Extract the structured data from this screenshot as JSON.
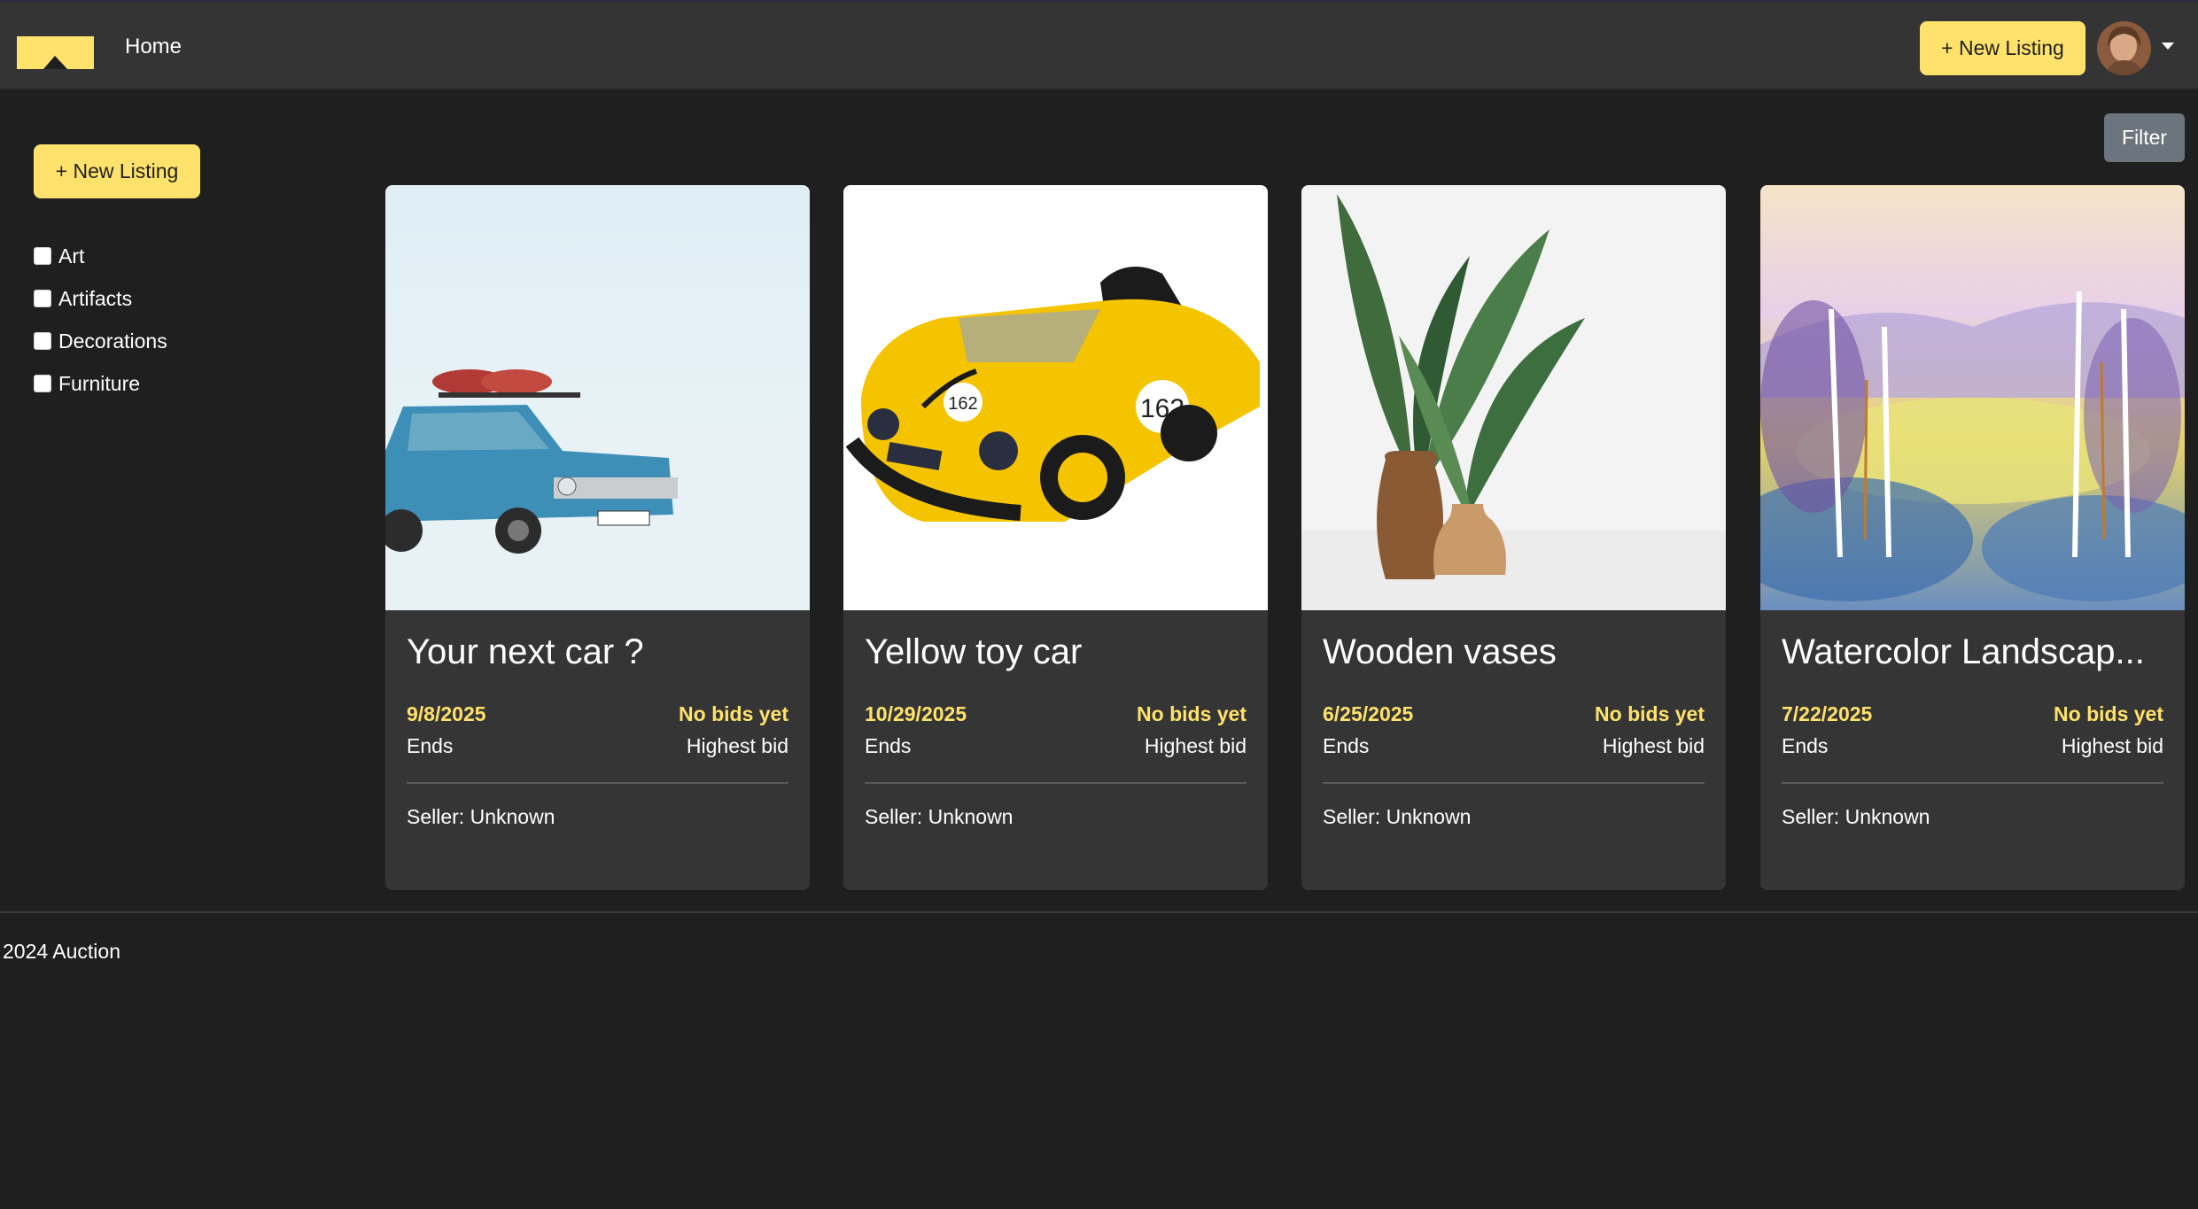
{
  "navbar": {
    "home_label": "Home",
    "new_listing_label": "+ New Listing"
  },
  "sidebar": {
    "new_listing_label": "+ New Listing",
    "categories": [
      {
        "label": "Art",
        "checked": false
      },
      {
        "label": "Artifacts",
        "checked": false
      },
      {
        "label": "Decorations",
        "checked": false
      },
      {
        "label": "Furniture",
        "checked": false
      }
    ]
  },
  "filter_label": "Filter",
  "listings": [
    {
      "title": "Your next car ?",
      "end_date": "9/8/2025",
      "ends_label": "Ends",
      "bid_value": "No bids yet",
      "bid_label": "Highest bid",
      "seller": "Seller: Unknown",
      "image_icon": "blue-car-snow-photo"
    },
    {
      "title": "Yellow toy car",
      "end_date": "10/29/2025",
      "ends_label": "Ends",
      "bid_value": "No bids yet",
      "bid_label": "Highest bid",
      "seller": "Seller: Unknown",
      "image_icon": "yellow-toy-car-photo",
      "plate_number": "162"
    },
    {
      "title": "Wooden vases",
      "end_date": "6/25/2025",
      "ends_label": "Ends",
      "bid_value": "No bids yet",
      "bid_label": "Highest bid",
      "seller": "Seller: Unknown",
      "image_icon": "wooden-vases-photo"
    },
    {
      "title": "Watercolor Landscap...",
      "end_date": "7/22/2025",
      "ends_label": "Ends",
      "bid_value": "No bids yet",
      "bid_label": "Highest bid",
      "seller": "Seller: Unknown",
      "image_icon": "watercolor-landscape-painting"
    }
  ],
  "footer": {
    "text": "2024 Auction"
  },
  "colors": {
    "accent": "#ffe26b",
    "background": "#1f1f1f",
    "navbar": "#343434",
    "card": "#353535",
    "filter_button": "#6c757d"
  }
}
